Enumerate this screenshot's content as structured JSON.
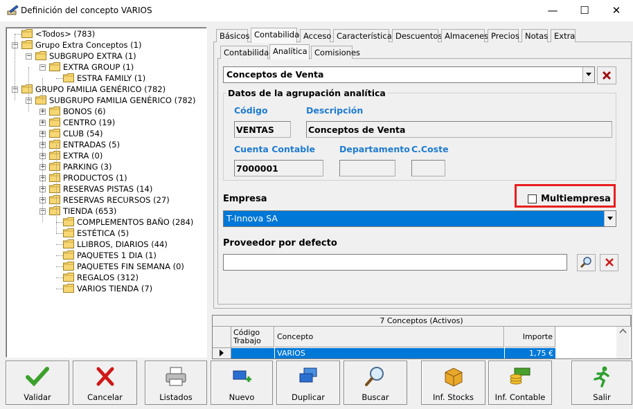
{
  "window": {
    "title": "Definición del concepto VARIOS",
    "minimize": "—",
    "maximize": "☐",
    "close": "✕"
  },
  "tree": {
    "items": [
      {
        "label": "<Todos> (783)",
        "level": 0,
        "expander": ""
      },
      {
        "label": "Grupo Extra Conceptos (1)",
        "level": 0,
        "expander": "−"
      },
      {
        "label": "SUBGRUPO EXTRA (1)",
        "level": 1,
        "expander": "−"
      },
      {
        "label": "EXTRA GROUP (1)",
        "level": 2,
        "expander": "−"
      },
      {
        "label": "ESTRA FAMILY (1)",
        "level": 3,
        "expander": ""
      },
      {
        "label": "GRUPO FAMILIA GENÉRICO (782)",
        "level": 0,
        "expander": "−"
      },
      {
        "label": "SUBGRUPO FAMILIA GENÉRICO (782)",
        "level": 1,
        "expander": "−"
      },
      {
        "label": "BONOS (6)",
        "level": 2,
        "expander": "+"
      },
      {
        "label": "CENTRO (19)",
        "level": 2,
        "expander": "+"
      },
      {
        "label": "CLUB (54)",
        "level": 2,
        "expander": "+"
      },
      {
        "label": "ENTRADAS (5)",
        "level": 2,
        "expander": "+"
      },
      {
        "label": "EXTRA (0)",
        "level": 2,
        "expander": "+"
      },
      {
        "label": "PARKING (3)",
        "level": 2,
        "expander": "+"
      },
      {
        "label": "PRODUCTOS (1)",
        "level": 2,
        "expander": "+"
      },
      {
        "label": "RESERVAS PISTAS (14)",
        "level": 2,
        "expander": "+"
      },
      {
        "label": "RESERVAS RECURSOS (27)",
        "level": 2,
        "expander": "+"
      },
      {
        "label": "TIENDA (653)",
        "level": 2,
        "expander": "−"
      },
      {
        "label": "COMPLEMENTOS BAÑO (284)",
        "level": 3,
        "expander": ""
      },
      {
        "label": "ESTÉTICA (5)",
        "level": 3,
        "expander": ""
      },
      {
        "label": "LLIBROS, DIARIOS (44)",
        "level": 3,
        "expander": ""
      },
      {
        "label": "PAQUETES 1 DIA (1)",
        "level": 3,
        "expander": ""
      },
      {
        "label": "PAQUETES FIN SEMANA (0)",
        "level": 3,
        "expander": ""
      },
      {
        "label": "REGALOS (312)",
        "level": 3,
        "expander": ""
      },
      {
        "label": "VARIOS TIENDA (7)",
        "level": 3,
        "expander": ""
      }
    ]
  },
  "tabs_main": [
    "Básicos",
    "Contabilidad",
    "Acceso",
    "Características",
    "Descuentos",
    "Almacenes",
    "Precios",
    "Notas",
    "Extra"
  ],
  "tabs_sub": [
    "Contabilidad",
    "Analítica",
    "Comisiones"
  ],
  "analitica": {
    "agrupacion_value": "Conceptos de Venta",
    "group_title": "Datos de la agrupación analítica",
    "codigo_label": "Código",
    "codigo_value": "VENTAS",
    "descripcion_label": "Descripción",
    "descripcion_value": "Conceptos de Venta",
    "cuenta_label": "Cuenta Contable",
    "cuenta_value": "7000001",
    "departamento_label": "Departamento",
    "departamento_value": "",
    "ccoste_label": "C.Coste",
    "ccoste_value": "",
    "empresa_label": "Empresa",
    "multiempresa_label": "Multiempresa",
    "multiempresa_checked": false,
    "empresa_value": "T-Innova SA",
    "proveedor_label": "Proveedor por defecto",
    "proveedor_value": ""
  },
  "grid": {
    "caption": "7 Conceptos (Activos)",
    "col_codigo": "Código\nTrabajo",
    "col_concepto": "Concepto",
    "col_importe": "Importe",
    "rows": [
      {
        "codigo": "",
        "concepto": "VARIOS",
        "importe": "1,75 €"
      }
    ]
  },
  "buttons": [
    {
      "name": "validar-button",
      "label": "Validar",
      "icon": "check-icon"
    },
    {
      "name": "cancelar-button",
      "label": "Cancelar",
      "icon": "x-icon"
    },
    {
      "name": "listados-button",
      "label": "Listados",
      "icon": "printer-icon"
    },
    {
      "name": "nuevo-button",
      "label": "Nuevo",
      "icon": "new-icon"
    },
    {
      "name": "duplicar-button",
      "label": "Duplicar",
      "icon": "duplicate-icon"
    },
    {
      "name": "buscar-button",
      "label": "Buscar",
      "icon": "magnifier-icon"
    },
    {
      "name": "inf-stocks-button",
      "label": "Inf. Stocks",
      "icon": "box-icon"
    },
    {
      "name": "inf-contable-button",
      "label": "Inf. Contable",
      "icon": "money-icon"
    },
    {
      "name": "salir-button",
      "label": "Salir",
      "icon": "running-man-icon"
    }
  ],
  "colors": {
    "selection": "#0078d7",
    "label_blue": "#1e7bd0",
    "highlight_box": "#e81e1e",
    "cancel_red": "#d01818",
    "validate_green": "#3ca02c"
  }
}
